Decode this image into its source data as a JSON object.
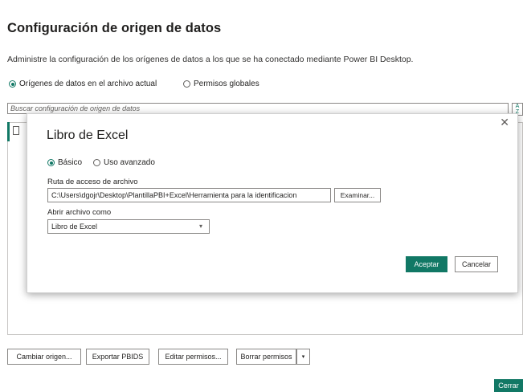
{
  "page": {
    "title": "Configuración de origen de datos",
    "description": "Administre la configuración de los orígenes de datos a los que se ha conectado mediante Power BI Desktop."
  },
  "scope": {
    "current_file_label": "Orígenes de datos en el archivo actual",
    "global_label": "Permisos globales",
    "selected": "current_file"
  },
  "search": {
    "placeholder": "Buscar configuración de origen de datos"
  },
  "actions": {
    "change_source": "Cambiar origen...",
    "export_pbids": "Exportar PBIDS",
    "edit_permissions": "Editar permisos...",
    "clear_permissions": "Borrar permisos",
    "close": "Cerrar"
  },
  "dialog": {
    "title": "Libro de Excel",
    "mode_basic": "Básico",
    "mode_advanced": "Uso avanzado",
    "selected_mode": "basic",
    "path_label": "Ruta de acceso de archivo",
    "path_value": "C:\\Users\\dgojr\\Desktop\\PlantillaPBI+Excel\\Herramienta para la identificacion",
    "browse": "Examinar...",
    "open_as_label": "Abrir archivo como",
    "open_as_value": "Libro de Excel",
    "accept": "Aceptar",
    "cancel": "Cancelar",
    "close_glyph": "✕"
  },
  "colors": {
    "accent": "#117865"
  },
  "icons": {
    "sort": "sort-az-icon",
    "file": "file-icon",
    "dropdown": "chevron-down-icon",
    "close": "close-icon"
  }
}
